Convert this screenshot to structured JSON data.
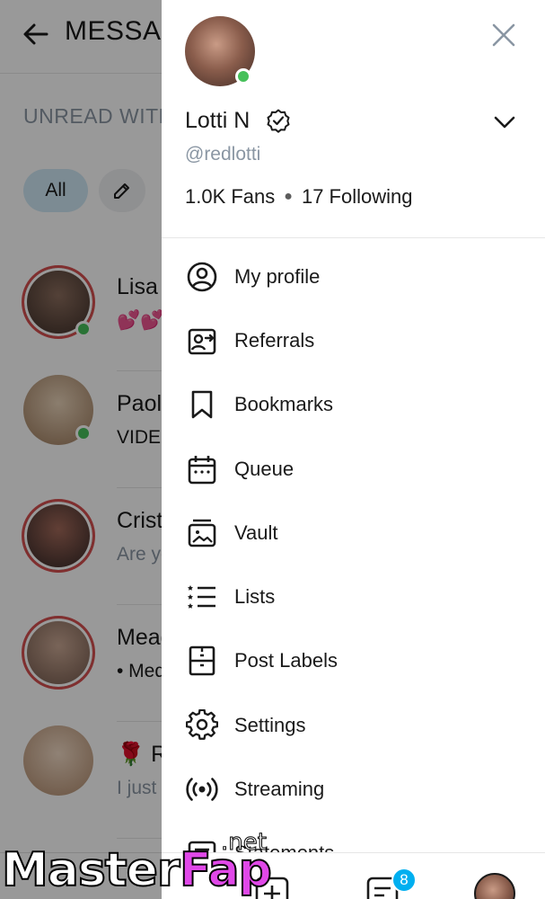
{
  "background": {
    "header_title": "MESSAGES",
    "subtitle": "UNREAD WITH TIPS",
    "filter_all": "All",
    "chats": [
      {
        "name": "Lisa",
        "preview": "💕💕"
      },
      {
        "name": "Paola",
        "preview": "VIDEO"
      },
      {
        "name": "Cristina",
        "preview": "Are you"
      },
      {
        "name": "Meaghan",
        "preview": "• Media"
      },
      {
        "name": "🌹 Rose",
        "preview": "I just"
      },
      {
        "name": "",
        "preview": ""
      }
    ]
  },
  "drawer": {
    "profile": {
      "name": "Lotti N",
      "handle": "@redlotti",
      "fans": "1.0K Fans",
      "following": "17 Following",
      "online": true
    },
    "menu": [
      {
        "label": "My profile",
        "icon": "profile-icon"
      },
      {
        "label": "Referrals",
        "icon": "referrals-icon"
      },
      {
        "label": "Bookmarks",
        "icon": "bookmark-icon"
      },
      {
        "label": "Queue",
        "icon": "calendar-icon"
      },
      {
        "label": "Vault",
        "icon": "vault-icon"
      },
      {
        "label": "Lists",
        "icon": "lists-icon"
      },
      {
        "label": "Post Labels",
        "icon": "post-labels-icon"
      },
      {
        "label": "Settings",
        "icon": "gear-icon"
      },
      {
        "label": "Streaming",
        "icon": "streaming-icon"
      },
      {
        "label": "Statements",
        "icon": "statements-icon"
      }
    ],
    "nav": {
      "messages_badge": "8"
    }
  },
  "watermark": {
    "part1": "Master",
    "part2": "Fap",
    "suffix": ".net"
  },
  "colors": {
    "accent": "#00aff0",
    "online": "#46c05a",
    "muted_text": "#8a96a3",
    "chip_bg": "#cfe8f5",
    "story_ring": "#d64f4f",
    "watermark_fap": "#e048e8"
  }
}
